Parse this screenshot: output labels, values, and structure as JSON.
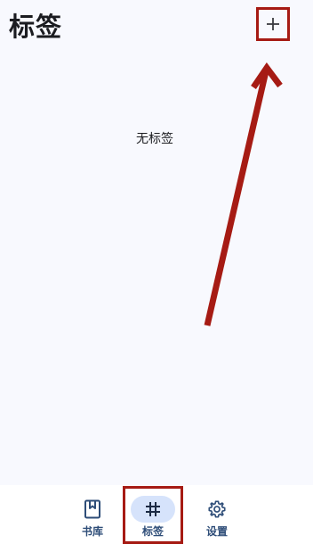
{
  "header": {
    "title": "标签",
    "add_icon": "plus-icon"
  },
  "main": {
    "empty_text": "无标签"
  },
  "bottom_nav": {
    "items": [
      {
        "label": "书库",
        "icon": "bookmark-book-icon",
        "active": false
      },
      {
        "label": "标签",
        "icon": "hashtag-icon",
        "active": true
      },
      {
        "label": "设置",
        "icon": "gear-icon",
        "active": false
      }
    ]
  },
  "colors": {
    "background": "#f8f9fe",
    "nav_active_pill": "#d6e3fb",
    "nav_label": "#2e4d78",
    "annotation_red": "#a61b14"
  }
}
